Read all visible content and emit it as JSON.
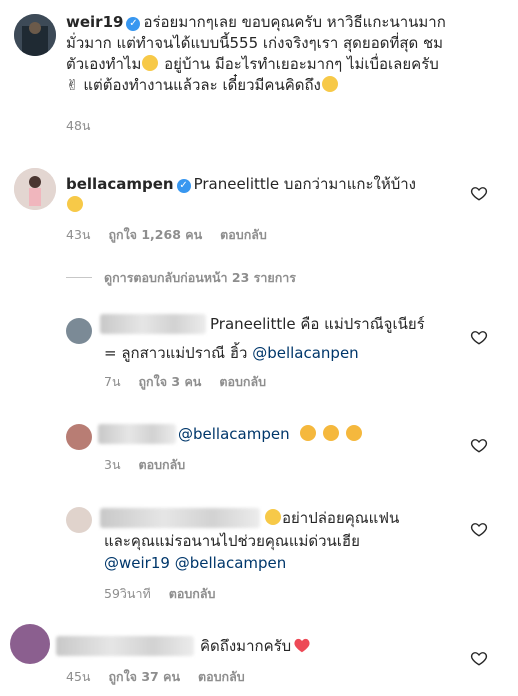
{
  "caption": {
    "username": "weir19",
    "text_line1": "อร่อยมากๆเลย ขอบคุณครับ หาวิธีแกะนานมาก",
    "text_line2": "มั่วมาก แต่ทำจนได้แบบนี้555 เก่งจริงๆเรา สุดยอดที่สุด ชม",
    "text_line3": "ตัวเองทำไม",
    "text_line3b": " อยู่บ้าน มีอะไรทำเยอะมากๆ ไม่เบื่อเลยครับ",
    "text_line4": " แต่ต้องทำงานแล้วละ เดี๋ยวมีคนคิดถึง",
    "time": "48น"
  },
  "comment1": {
    "username": "bellacampen",
    "text": "Praneelittle บอกว่ามาแกะให้บ้าง",
    "time": "43น",
    "likes": "ถูกใจ 1,268 คน",
    "reply": "ตอบกลับ"
  },
  "view_replies": "ดูการตอบกลับก่อนหน้า 23 รายการ",
  "reply1": {
    "text_line1": "Praneelittle คือ แม่ปราณีจูเนียร์",
    "text_line2": "= ลูกสาวแม่ปราณี ฮิ้ว ",
    "mention": "@bellacanpen",
    "time": "7น",
    "likes": "ถูกใจ 3 คน",
    "reply": "ตอบกลับ"
  },
  "reply2": {
    "mention": "@bellacampen",
    "time": "3น",
    "reply": "ตอบกลับ"
  },
  "reply3": {
    "text_line1": "อย่าปล่อยคุณแฟน",
    "text_line2": "และคุณแม่รอนานไปช่วยคุณแม่ด่วนเฮีย",
    "mention1": "@weir19",
    "mention2": "@bellacampen",
    "time": "59วินาที",
    "reply": "ตอบกลับ"
  },
  "reply4": {
    "text": "คิดถึงมากครับ",
    "time": "45น",
    "likes": "ถูกใจ 37 คน",
    "reply": "ตอบกลับ"
  },
  "colors": {
    "link": "#00376b",
    "verified": "#3897f0",
    "muted": "#8e8e8e",
    "heart_red": "#ed4956"
  }
}
